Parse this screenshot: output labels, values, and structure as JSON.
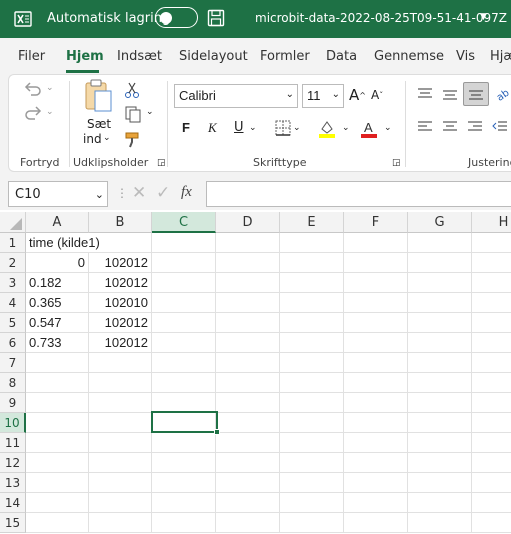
{
  "titlebar": {
    "autosave_label": "Automatisk lagring",
    "filename": "microbit-data-2022-08-25T09-51-41-097Z"
  },
  "tabs": [
    {
      "label": "Filer"
    },
    {
      "label": "Hjem"
    },
    {
      "label": "Indsæt"
    },
    {
      "label": "Sidelayout"
    },
    {
      "label": "Formler"
    },
    {
      "label": "Data"
    },
    {
      "label": "Gennemse"
    },
    {
      "label": "Vis"
    },
    {
      "label": "Hjæ"
    }
  ],
  "ribbon": {
    "groups": {
      "undo": "Fortryd",
      "clipboard": "Udklipsholder",
      "font": "Skrifttype",
      "align": "Justering"
    },
    "paste_label_1": "Sæt",
    "paste_label_2": "ind",
    "font_name": "Calibri",
    "font_size": "11",
    "bold": "F",
    "italic": "K",
    "underline": "U",
    "colors": {
      "highlight": "#ffff00",
      "font_color": "#e02020",
      "accent": "#1e7145"
    }
  },
  "formula_bar": {
    "name_box": "C10",
    "fx_label": "fx",
    "formula": ""
  },
  "grid": {
    "columns": [
      "A",
      "B",
      "C",
      "D",
      "E",
      "F",
      "G",
      "H"
    ],
    "rows": [
      "1",
      "2",
      "3",
      "4",
      "5",
      "6",
      "7",
      "8",
      "9",
      "10",
      "11",
      "12",
      "13",
      "14",
      "15"
    ],
    "selected_cell": "C10",
    "cells": {
      "A1": "time (kilde1)",
      "A2": "0",
      "B2": "102012",
      "A3": "0.182",
      "B3": "102012",
      "A4": "0.365",
      "B4": "102010",
      "A5": "0.547",
      "B5": "102012",
      "A6": "0.733",
      "B6": "102012"
    }
  }
}
